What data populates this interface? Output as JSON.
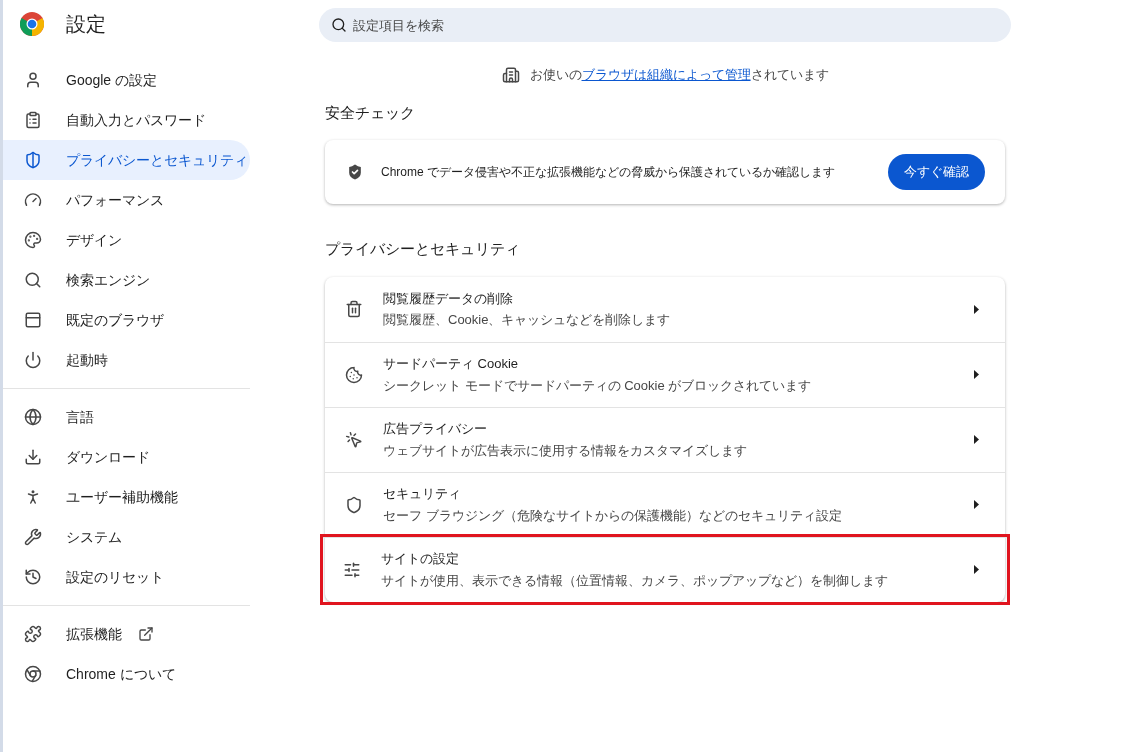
{
  "header": {
    "title": "設定"
  },
  "search": {
    "placeholder": "設定項目を検索"
  },
  "sidebar": {
    "groups": [
      [
        {
          "label": "Google の設定",
          "selected": false
        },
        {
          "label": "自動入力とパスワード",
          "selected": false
        },
        {
          "label": "プライバシーとセキュリティ",
          "selected": true
        },
        {
          "label": "パフォーマンス",
          "selected": false
        },
        {
          "label": "デザイン",
          "selected": false
        },
        {
          "label": "検索エンジン",
          "selected": false
        },
        {
          "label": "既定のブラウザ",
          "selected": false
        },
        {
          "label": "起動時",
          "selected": false
        }
      ],
      [
        {
          "label": "言語",
          "selected": false
        },
        {
          "label": "ダウンロード",
          "selected": false
        },
        {
          "label": "ユーザー補助機能",
          "selected": false
        },
        {
          "label": "システム",
          "selected": false
        },
        {
          "label": "設定のリセット",
          "selected": false
        }
      ],
      [
        {
          "label": "拡張機能",
          "selected": false,
          "external": true
        },
        {
          "label": "Chrome について",
          "selected": false
        }
      ]
    ]
  },
  "managed_notice": {
    "before": "お使いの",
    "link": "ブラウザは組織によって管理",
    "after": "されています"
  },
  "safety_check": {
    "heading": "安全チェック",
    "text": "Chrome でデータ侵害や不正な拡張機能などの脅威から保護されているか確認します",
    "button": "今すぐ確認"
  },
  "privacy": {
    "heading": "プライバシーとセキュリティ",
    "rows": [
      {
        "title": "閲覧履歴データの削除",
        "subtitle": "閲覧履歴、Cookie、キャッシュなどを削除します",
        "highlighted": false
      },
      {
        "title": "サードパーティ Cookie",
        "subtitle": "シークレット モードでサードパーティの Cookie がブロックされています",
        "highlighted": false
      },
      {
        "title": "広告プライバシー",
        "subtitle": "ウェブサイトが広告表示に使用する情報をカスタマイズします",
        "highlighted": false
      },
      {
        "title": "セキュリティ",
        "subtitle": "セーフ ブラウジング（危険なサイトからの保護機能）などのセキュリティ設定",
        "highlighted": false
      },
      {
        "title": "サイトの設定",
        "subtitle": "サイトが使用、表示できる情報（位置情報、カメラ、ポップアップなど）を制御します",
        "highlighted": true
      }
    ]
  }
}
